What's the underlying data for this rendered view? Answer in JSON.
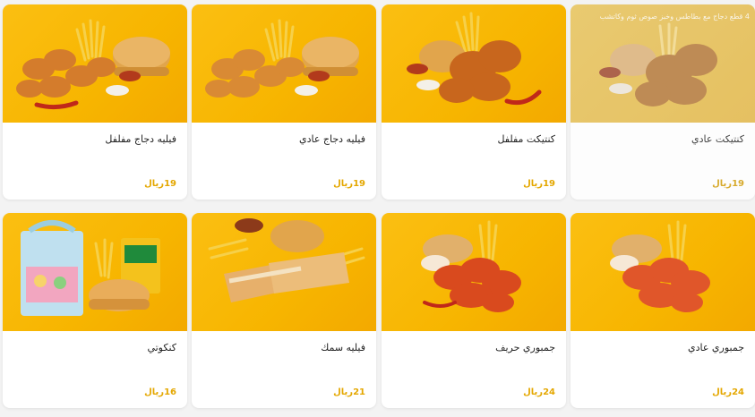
{
  "currency_label": "ريال",
  "cards": [
    {
      "name": "فيليه دجاج مفلفل",
      "price": "19",
      "image": "nuggets-burger-icon"
    },
    {
      "name": "فيليه دجاج عادي",
      "price": "19",
      "image": "nuggets-burger-icon"
    },
    {
      "name": "كنتيكت مفلفل",
      "price": "19",
      "image": "fried-chicken-icon"
    },
    {
      "name": "كنتيكت عادي",
      "price": "19",
      "image": "fried-chicken-icon",
      "promo": "4 قطع دجاج مع بطاطس وخبز صوص ثوم وكاتشب"
    },
    {
      "name": "كنكوتي",
      "price": "16",
      "image": "kids-meal-icon"
    },
    {
      "name": "فيليه سمك",
      "price": "21",
      "image": "fish-fillet-icon"
    },
    {
      "name": "جمبوري حريف",
      "price": "24",
      "image": "shrimp-icon"
    },
    {
      "name": "جمبوري عادي",
      "price": "24",
      "image": "shrimp-icon"
    }
  ],
  "colors": {
    "accent": "#f7b500",
    "price": "#e4a700",
    "card": "#ffffff",
    "bg": "#f3f3f3"
  }
}
